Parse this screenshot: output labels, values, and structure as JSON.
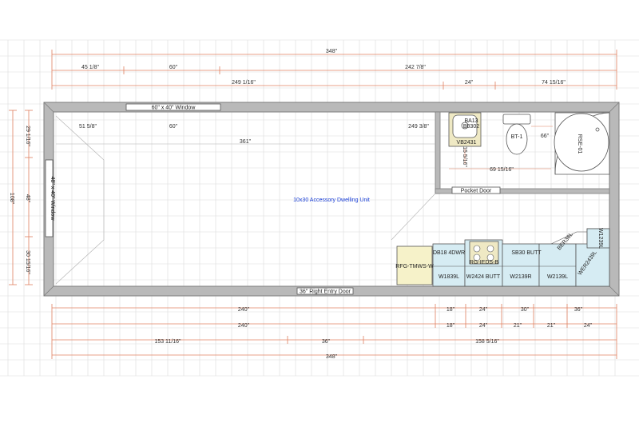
{
  "plan": {
    "title": "10x30 Accessory Dwelling Unit",
    "colors": {
      "grid": "#dcdcdc",
      "wall": "#8a8a8a",
      "wall_fill": "#b9b9b9",
      "dimension": "#e08060",
      "base_cabinet": "#d6ecf3",
      "fridge": "#f6f2c9",
      "appliance": "#efe9c4",
      "title": "#1a3fd6"
    },
    "top_dimensions": {
      "overall": "348\"",
      "left_offset": "45 1/8\"",
      "window_width": "60\"",
      "right_run": "242 7/8\"",
      "to_bath": "249 1/16\"",
      "bath_a": "24\"",
      "bath_b": "74 15/16\""
    },
    "interior_dimensions": {
      "left_clear": "51 5/8\"",
      "window": "60\"",
      "right_clear": "249 3/8\"",
      "length": "361\"",
      "toilet_clear": "66\"",
      "vanity_depth": "15 5/16\"",
      "bath_width": "69 15/16\""
    },
    "left_dimensions": {
      "top": "29 1/16\"",
      "window": "48\"",
      "overall": "108\"",
      "bottom": "30 15/16\""
    },
    "bottom_dimensions": {
      "row1": [
        "240\"",
        "18\"",
        "24\"",
        "30\"",
        "36\""
      ],
      "row2": [
        "240\"",
        "18\"",
        "24\"",
        "21\"",
        "21\"",
        "24\""
      ],
      "row3": [
        "153 11/16\"",
        "36\"",
        "158 5/16\""
      ],
      "overall": "348\""
    },
    "openings": {
      "top_window": "60\" x 40\" Window",
      "left_window": "48\" x 40\" Window",
      "entry_door": "36\" Right Entry Door",
      "pocket_door": "Pocket Door"
    },
    "fixtures": {
      "vanity": "VB2431",
      "sink": "BA13",
      "vanity_sink": "B0302",
      "toilet": "BT-1",
      "shower": "RSE-01",
      "vanity_dim": "15 5/16\""
    },
    "cabinets": {
      "fridge": "RFG-TMWS-W",
      "drawer_base": "DB18 4DWR",
      "range": "RG-IEDS-B",
      "sink_base": "SB30 BUTT",
      "corner_base": "BER36L",
      "wall_corner": "WER2439L",
      "wall_top": "W1239L",
      "wall_1": "W1839L",
      "wall_2": "W2424 BUTT",
      "wall_3": "W2139R",
      "wall_4": "W2139L"
    }
  }
}
